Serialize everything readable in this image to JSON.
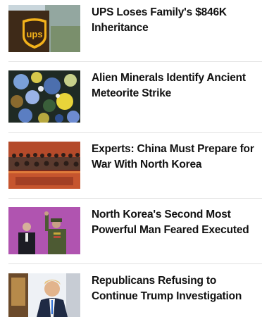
{
  "feed": {
    "items": [
      {
        "headline": "UPS Loses Family's $846K Inheritance",
        "image": "ups-logo-truck-photo"
      },
      {
        "headline": "Alien Minerals Identify Ancient Meteorite Strike",
        "image": "microscope-mineral-photo"
      },
      {
        "headline": "Experts: China Must Prepare for War With North Korea",
        "image": "assembly-hall-photo"
      },
      {
        "headline": "North Korea's Second Most Powerful Man Feared Executed",
        "image": "officials-saluting-photo"
      },
      {
        "headline": "Republicans Refusing to Continue Trump Investigation",
        "image": "trump-portrait-photo"
      }
    ]
  }
}
